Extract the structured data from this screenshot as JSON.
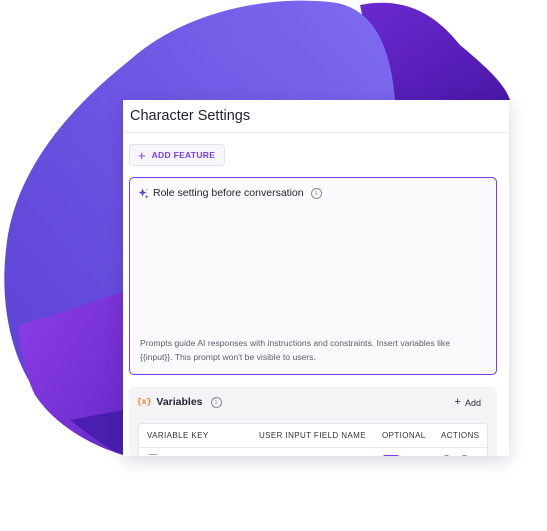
{
  "panel": {
    "title": "Character Settings"
  },
  "toolbar": {
    "add_feature_icon": "+",
    "add_feature_label": "ADD FEATURE"
  },
  "role": {
    "icon": "sparkle-icon",
    "title": "Role setting before conversation",
    "info_icon": "i",
    "help": "Prompts guide AI responses with instructions and constraints. Insert variables like {{input}}. This prompt won't be visible to users."
  },
  "variables": {
    "icon_label": "{x}",
    "title": "Variables",
    "info_icon": "i",
    "add_icon": "+",
    "add_label": "Add",
    "columns": [
      "VARIABLE KEY",
      "USER INPUT FIELD NAME",
      "OPTIONAL",
      "ACTIONS"
    ]
  },
  "colors": {
    "accent": "#7c3aed",
    "variable_icon": "#f97316",
    "blob_light": "#7b63ea",
    "blob_dark": "#4a1fb0"
  }
}
